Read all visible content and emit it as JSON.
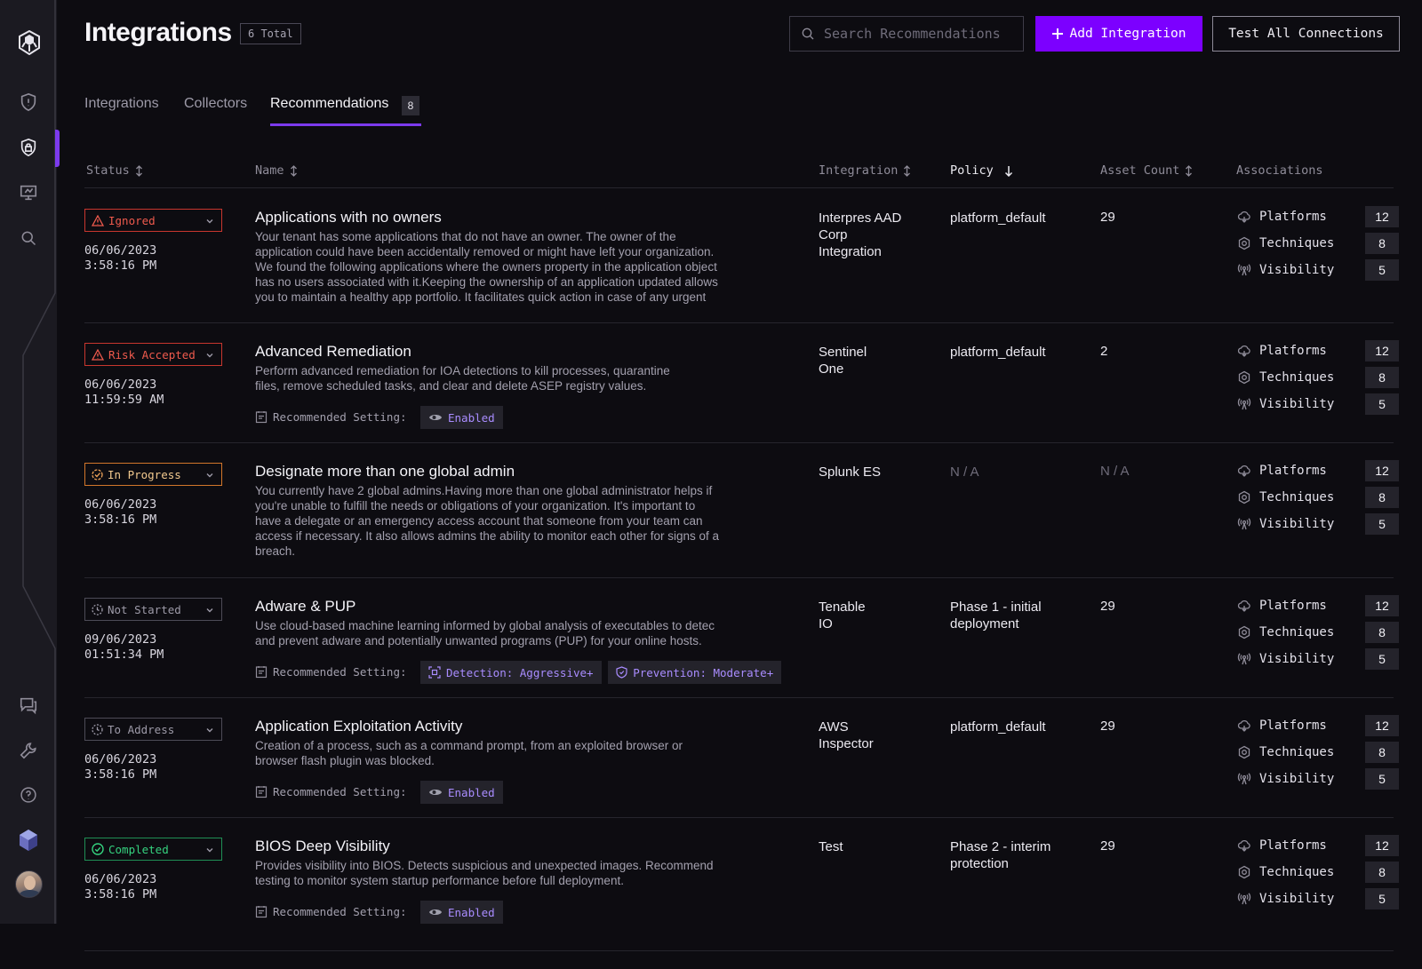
{
  "header": {
    "title": "Integrations",
    "total_badge": "6 Total",
    "search_placeholder": "Search Recommendations",
    "add_button": "Add Integration",
    "test_button": "Test All Connections"
  },
  "tabs": [
    {
      "label": "Integrations"
    },
    {
      "label": "Collectors"
    },
    {
      "label": "Recommendations",
      "count": "8",
      "active": true
    }
  ],
  "columns": {
    "status": "Status",
    "name": "Name",
    "integration": "Integration",
    "policy": "Policy",
    "asset_count": "Asset Count",
    "associations": "Associations"
  },
  "sidebar": {
    "icons": [
      "shield-alert-icon",
      "shield-lock-icon",
      "monitor-icon",
      "search-icon",
      "chat-icon",
      "wrench-icon",
      "help-icon",
      "hex-logo-icon"
    ]
  },
  "colors": {
    "accent": "#7c00ff",
    "ignored": "#ef5a4d",
    "in_progress": "#f0a45a",
    "completed": "#35d27f",
    "chip_text": "#a98cff"
  },
  "rec_label": "Recommended Setting:",
  "assoc_labels": {
    "platforms": "Platforms",
    "techniques": "Techniques",
    "visibility": "Visibility"
  },
  "rows": [
    {
      "status": "Ignored",
      "date": "06/06/2023",
      "time": "3:58:16 PM",
      "name": "Applications with no owners",
      "desc": [
        "Your tenant has some applications that do not have an owner. The owner of the",
        "application could have been accidentally removed or might have left your organization.",
        "We found the following applications where the owners property in the application object",
        "has no users associated with it.Keeping the ownership of an application updated allows",
        "you to maintain a healthy app portfolio. It facilitates quick action in case of any urgent"
      ],
      "integration": [
        "Interpres AAD",
        "Corp",
        "Integration"
      ],
      "policy": [
        "platform_default"
      ],
      "asset_count": "29",
      "counts": {
        "platforms": "12",
        "techniques": "8",
        "visibility": "5"
      }
    },
    {
      "status": "Risk Accepted",
      "date": "06/06/2023",
      "time": "11:59:59 AM",
      "name": "Advanced Remediation",
      "desc": [
        "Perform advanced remediation for IOA detections to kill processes, quarantine",
        "files, remove scheduled tasks, and clear and delete ASEP registry values."
      ],
      "chips": [
        "Enabled"
      ],
      "integration": [
        "Sentinel",
        "One"
      ],
      "policy": [
        "platform_default"
      ],
      "asset_count": "2",
      "counts": {
        "platforms": "12",
        "techniques": "8",
        "visibility": "5"
      }
    },
    {
      "status": "In Progress",
      "date": "06/06/2023",
      "time": "3:58:16 PM",
      "name": "Designate more than one global admin",
      "desc": [
        "You currently have 2 global admins.Having more than one global administrator helps if",
        "you're unable to fulfill the needs or obligations of your organization. It's important to",
        "have a delegate or an emergency access account that someone from your team can",
        "access if necessary. It also allows admins the ability to monitor each other for signs of a",
        "breach."
      ],
      "integration": [
        "Splunk ES"
      ],
      "policy": [
        "N / A"
      ],
      "asset_count": "N / A",
      "counts": {
        "platforms": "12",
        "techniques": "8",
        "visibility": "5"
      }
    },
    {
      "status": "Not Started",
      "date": "09/06/2023",
      "time": "01:51:34 PM",
      "name": "Adware & PUP",
      "desc": [
        "Use cloud-based machine learning informed by global analysis of executables to detec",
        "and prevent adware and potentially unwanted programs (PUP) for your online hosts."
      ],
      "chips": [
        "Detection: Aggressive+",
        "Prevention: Moderate+"
      ],
      "integration": [
        "Tenable",
        "IO"
      ],
      "policy": [
        "Phase 1 - initial",
        "deployment"
      ],
      "asset_count": "29",
      "counts": {
        "platforms": "12",
        "techniques": "8",
        "visibility": "5"
      }
    },
    {
      "status": "To Address",
      "date": "06/06/2023",
      "time": "3:58:16 PM",
      "name": "Application Exploitation Activity",
      "desc": [
        "Creation of a process, such as a command prompt, from an exploited browser or",
        "browser flash plugin was blocked."
      ],
      "chips": [
        "Enabled"
      ],
      "integration": [
        "AWS",
        "Inspector"
      ],
      "policy": [
        "platform_default"
      ],
      "asset_count": "29",
      "counts": {
        "platforms": "12",
        "techniques": "8",
        "visibility": "5"
      }
    },
    {
      "status": "Completed",
      "date": "06/06/2023",
      "time": "3:58:16 PM",
      "name": "BIOS Deep Visibility",
      "desc": [
        "Provides visibility into BIOS. Detects suspicious and unexpected images. Recommend",
        "testing to monitor system startup performance before full deployment."
      ],
      "chips": [
        "Enabled"
      ],
      "integration": [
        "Test"
      ],
      "policy": [
        "Phase 2 - interim",
        "protection"
      ],
      "asset_count": "29",
      "counts": {
        "platforms": "12",
        "techniques": "8",
        "visibility": "5"
      }
    }
  ]
}
